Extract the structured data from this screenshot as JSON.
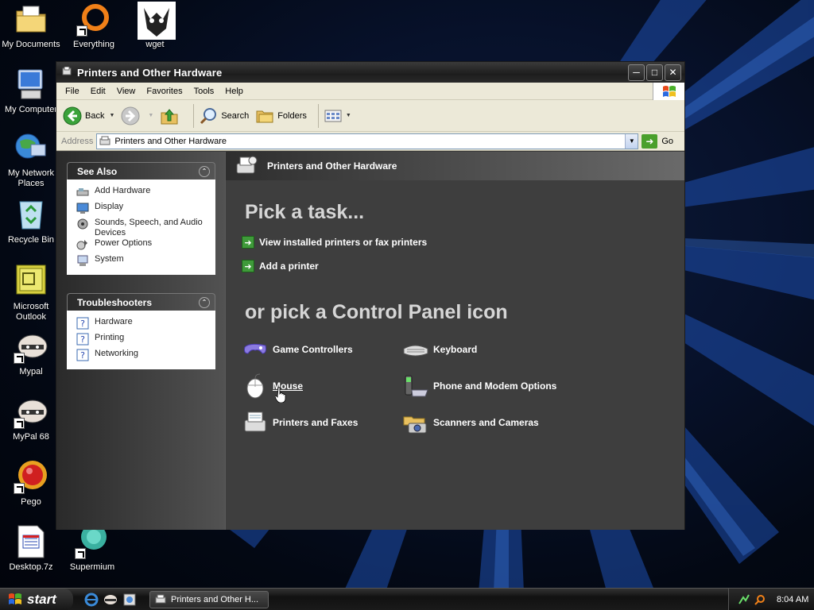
{
  "desktop": {
    "icons": [
      {
        "label": "My Documents"
      },
      {
        "label": "Everything"
      },
      {
        "label": "wget"
      },
      {
        "label": "My Computer"
      },
      {
        "label": "My Network Places"
      },
      {
        "label": "Recycle Bin"
      },
      {
        "label": "Microsoft Outlook"
      },
      {
        "label": "Mypal"
      },
      {
        "label": "MyPal 68"
      },
      {
        "label": "Pego"
      },
      {
        "label": "Desktop.7z"
      },
      {
        "label": "Supermium"
      }
    ]
  },
  "window": {
    "title": "Printers and Other Hardware",
    "menu": [
      "File",
      "Edit",
      "View",
      "Favorites",
      "Tools",
      "Help"
    ],
    "toolbar": {
      "back_label": "Back",
      "search_label": "Search",
      "folders_label": "Folders"
    },
    "address": {
      "label": "Address",
      "value": "Printers and Other Hardware",
      "go_label": "Go"
    }
  },
  "left_pane": {
    "see_also": {
      "title": "See Also",
      "items": [
        {
          "label": "Add Hardware",
          "icon": "add-hardware-icon"
        },
        {
          "label": "Display",
          "icon": "display-icon"
        },
        {
          "label": "Sounds, Speech, and Audio Devices",
          "icon": "sounds-icon"
        },
        {
          "label": "Power Options",
          "icon": "power-options-icon"
        },
        {
          "label": "System",
          "icon": "system-icon"
        }
      ]
    },
    "troubleshooters": {
      "title": "Troubleshooters",
      "items": [
        {
          "label": "Hardware",
          "icon": "help-icon"
        },
        {
          "label": "Printing",
          "icon": "help-icon"
        },
        {
          "label": "Networking",
          "icon": "help-icon"
        }
      ]
    }
  },
  "main": {
    "header_title": "Printers and Other Hardware",
    "pick_task": "Pick a task...",
    "tasks": [
      {
        "label": "View installed printers or fax printers"
      },
      {
        "label": "Add a printer"
      }
    ],
    "or_pick": "or pick a Control Panel icon",
    "cp_icons": [
      {
        "label": "Game Controllers",
        "icon": "game-controller-icon"
      },
      {
        "label": "Keyboard",
        "icon": "keyboard-icon"
      },
      {
        "label": "Mouse",
        "icon": "mouse-icon"
      },
      {
        "label": "Phone and Modem Options",
        "icon": "phone-modem-icon"
      },
      {
        "label": "Printers and Faxes",
        "icon": "printer-fax-icon"
      },
      {
        "label": "Scanners and Cameras",
        "icon": "scanner-camera-icon"
      }
    ]
  },
  "taskbar": {
    "start_label": "start",
    "task_item": "Printers and Other H...",
    "clock": "8:04 AM"
  }
}
